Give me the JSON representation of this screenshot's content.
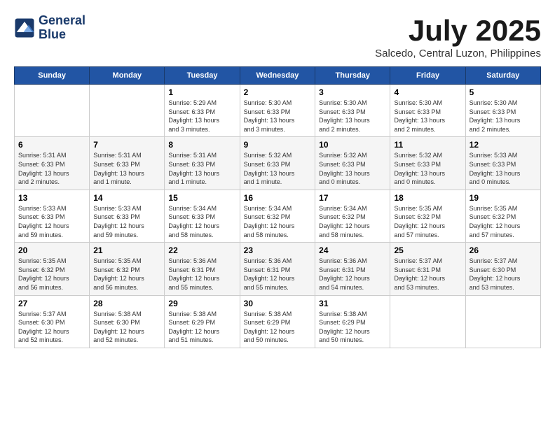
{
  "header": {
    "logo_line1": "General",
    "logo_line2": "Blue",
    "month_title": "July 2025",
    "subtitle": "Salcedo, Central Luzon, Philippines"
  },
  "weekdays": [
    "Sunday",
    "Monday",
    "Tuesday",
    "Wednesday",
    "Thursday",
    "Friday",
    "Saturday"
  ],
  "weeks": [
    [
      {
        "day": "",
        "info": ""
      },
      {
        "day": "",
        "info": ""
      },
      {
        "day": "1",
        "info": "Sunrise: 5:29 AM\nSunset: 6:33 PM\nDaylight: 13 hours\nand 3 minutes."
      },
      {
        "day": "2",
        "info": "Sunrise: 5:30 AM\nSunset: 6:33 PM\nDaylight: 13 hours\nand 3 minutes."
      },
      {
        "day": "3",
        "info": "Sunrise: 5:30 AM\nSunset: 6:33 PM\nDaylight: 13 hours\nand 2 minutes."
      },
      {
        "day": "4",
        "info": "Sunrise: 5:30 AM\nSunset: 6:33 PM\nDaylight: 13 hours\nand 2 minutes."
      },
      {
        "day": "5",
        "info": "Sunrise: 5:30 AM\nSunset: 6:33 PM\nDaylight: 13 hours\nand 2 minutes."
      }
    ],
    [
      {
        "day": "6",
        "info": "Sunrise: 5:31 AM\nSunset: 6:33 PM\nDaylight: 13 hours\nand 2 minutes."
      },
      {
        "day": "7",
        "info": "Sunrise: 5:31 AM\nSunset: 6:33 PM\nDaylight: 13 hours\nand 1 minute."
      },
      {
        "day": "8",
        "info": "Sunrise: 5:31 AM\nSunset: 6:33 PM\nDaylight: 13 hours\nand 1 minute."
      },
      {
        "day": "9",
        "info": "Sunrise: 5:32 AM\nSunset: 6:33 PM\nDaylight: 13 hours\nand 1 minute."
      },
      {
        "day": "10",
        "info": "Sunrise: 5:32 AM\nSunset: 6:33 PM\nDaylight: 13 hours\nand 0 minutes."
      },
      {
        "day": "11",
        "info": "Sunrise: 5:32 AM\nSunset: 6:33 PM\nDaylight: 13 hours\nand 0 minutes."
      },
      {
        "day": "12",
        "info": "Sunrise: 5:33 AM\nSunset: 6:33 PM\nDaylight: 13 hours\nand 0 minutes."
      }
    ],
    [
      {
        "day": "13",
        "info": "Sunrise: 5:33 AM\nSunset: 6:33 PM\nDaylight: 12 hours\nand 59 minutes."
      },
      {
        "day": "14",
        "info": "Sunrise: 5:33 AM\nSunset: 6:33 PM\nDaylight: 12 hours\nand 59 minutes."
      },
      {
        "day": "15",
        "info": "Sunrise: 5:34 AM\nSunset: 6:33 PM\nDaylight: 12 hours\nand 58 minutes."
      },
      {
        "day": "16",
        "info": "Sunrise: 5:34 AM\nSunset: 6:32 PM\nDaylight: 12 hours\nand 58 minutes."
      },
      {
        "day": "17",
        "info": "Sunrise: 5:34 AM\nSunset: 6:32 PM\nDaylight: 12 hours\nand 58 minutes."
      },
      {
        "day": "18",
        "info": "Sunrise: 5:35 AM\nSunset: 6:32 PM\nDaylight: 12 hours\nand 57 minutes."
      },
      {
        "day": "19",
        "info": "Sunrise: 5:35 AM\nSunset: 6:32 PM\nDaylight: 12 hours\nand 57 minutes."
      }
    ],
    [
      {
        "day": "20",
        "info": "Sunrise: 5:35 AM\nSunset: 6:32 PM\nDaylight: 12 hours\nand 56 minutes."
      },
      {
        "day": "21",
        "info": "Sunrise: 5:35 AM\nSunset: 6:32 PM\nDaylight: 12 hours\nand 56 minutes."
      },
      {
        "day": "22",
        "info": "Sunrise: 5:36 AM\nSunset: 6:31 PM\nDaylight: 12 hours\nand 55 minutes."
      },
      {
        "day": "23",
        "info": "Sunrise: 5:36 AM\nSunset: 6:31 PM\nDaylight: 12 hours\nand 55 minutes."
      },
      {
        "day": "24",
        "info": "Sunrise: 5:36 AM\nSunset: 6:31 PM\nDaylight: 12 hours\nand 54 minutes."
      },
      {
        "day": "25",
        "info": "Sunrise: 5:37 AM\nSunset: 6:31 PM\nDaylight: 12 hours\nand 53 minutes."
      },
      {
        "day": "26",
        "info": "Sunrise: 5:37 AM\nSunset: 6:30 PM\nDaylight: 12 hours\nand 53 minutes."
      }
    ],
    [
      {
        "day": "27",
        "info": "Sunrise: 5:37 AM\nSunset: 6:30 PM\nDaylight: 12 hours\nand 52 minutes."
      },
      {
        "day": "28",
        "info": "Sunrise: 5:38 AM\nSunset: 6:30 PM\nDaylight: 12 hours\nand 52 minutes."
      },
      {
        "day": "29",
        "info": "Sunrise: 5:38 AM\nSunset: 6:29 PM\nDaylight: 12 hours\nand 51 minutes."
      },
      {
        "day": "30",
        "info": "Sunrise: 5:38 AM\nSunset: 6:29 PM\nDaylight: 12 hours\nand 50 minutes."
      },
      {
        "day": "31",
        "info": "Sunrise: 5:38 AM\nSunset: 6:29 PM\nDaylight: 12 hours\nand 50 minutes."
      },
      {
        "day": "",
        "info": ""
      },
      {
        "day": "",
        "info": ""
      }
    ]
  ]
}
